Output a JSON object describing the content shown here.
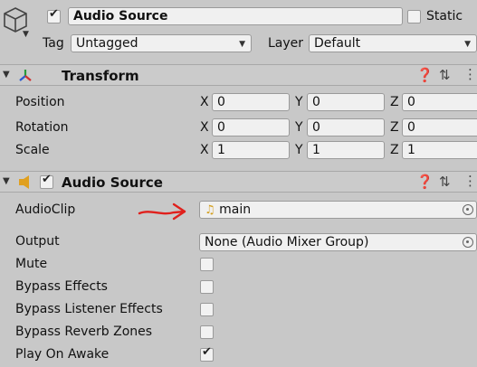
{
  "header": {
    "object_name": "Audio Source",
    "static_label": "Static",
    "tag_label": "Tag",
    "tag_value": "Untagged",
    "layer_label": "Layer",
    "layer_value": "Default",
    "icon": "cube-icon"
  },
  "transform": {
    "title": "Transform",
    "icon": "transform-axes-icon",
    "rows": [
      {
        "label": "Position",
        "x": "0",
        "y": "0",
        "z": "0"
      },
      {
        "label": "Rotation",
        "x": "0",
        "y": "0",
        "z": "0"
      },
      {
        "label": "Scale",
        "x": "1",
        "y": "1",
        "z": "1"
      }
    ],
    "axis_x": "X",
    "axis_y": "Y",
    "axis_z": "Z"
  },
  "audio_source": {
    "title": "Audio Source",
    "icon": "speaker-icon",
    "enabled": true,
    "audioclip_label": "AudioClip",
    "audioclip_value": "main",
    "output_label": "Output",
    "output_value": "None (Audio Mixer Group)",
    "toggles": [
      {
        "label": "Mute",
        "checked": false
      },
      {
        "label": "Bypass Effects",
        "checked": false
      },
      {
        "label": "Bypass Listener Effects",
        "checked": false
      },
      {
        "label": "Bypass Reverb Zones",
        "checked": false
      },
      {
        "label": "Play On Awake",
        "checked": true
      }
    ]
  },
  "colors": {
    "background": "#c8c8c8",
    "field": "#f0f0f0",
    "annotation_arrow": "#e0201c",
    "speaker": "#e0a020"
  }
}
